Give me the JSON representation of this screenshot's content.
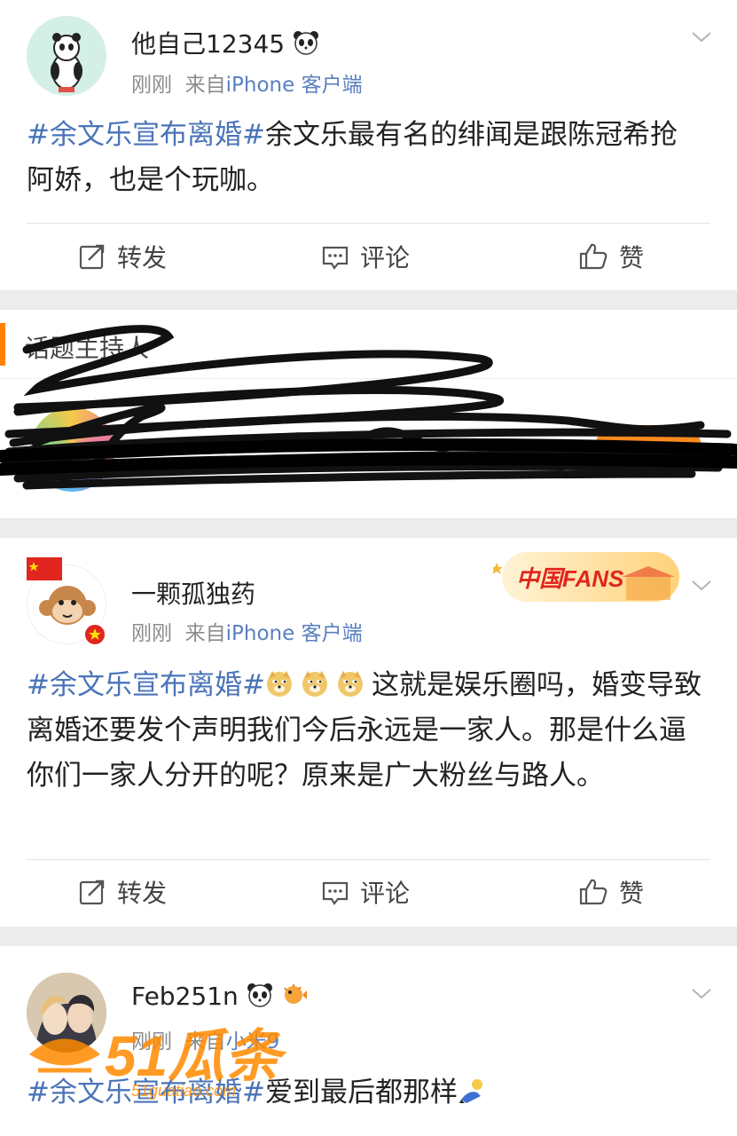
{
  "posts": [
    {
      "username": "他自己12345",
      "time": "刚刚",
      "source_prefix": "来自",
      "source": "iPhone 客户端",
      "hashtag": "#余文乐宣布离婚#",
      "text": "余文乐最有名的绯闻是跟陈冠希抢阿娇，也是个玩咖。"
    },
    {
      "username": "一颗孤独药",
      "time": "刚刚",
      "source_prefix": "来自",
      "source": "iPhone 客户端",
      "badge": "中国FANS",
      "hashtag": "#余文乐宣布离婚#",
      "text": "这就是娱乐圈吗，婚变导致离婚还要发个声明我们今后永远是一家人。那是什么逼你们一家人分开的呢？原来是广大粉丝与路人。"
    },
    {
      "username": "Feb251n",
      "time": "刚刚",
      "source_prefix": "来自",
      "source": "小米9",
      "hashtag": "#余文乐宣布离婚#",
      "text": "爱到最后都那样"
    }
  ],
  "actions": {
    "repost": "转发",
    "comment": "评论",
    "like": "赞"
  },
  "topic_section": {
    "title": "话题主持人"
  },
  "watermark": {
    "text": "51瓜条",
    "sub": "51guatiao.com"
  },
  "colors": {
    "link": "#4a74b8",
    "accent": "#ff8200",
    "meta": "#8c8c8c"
  }
}
